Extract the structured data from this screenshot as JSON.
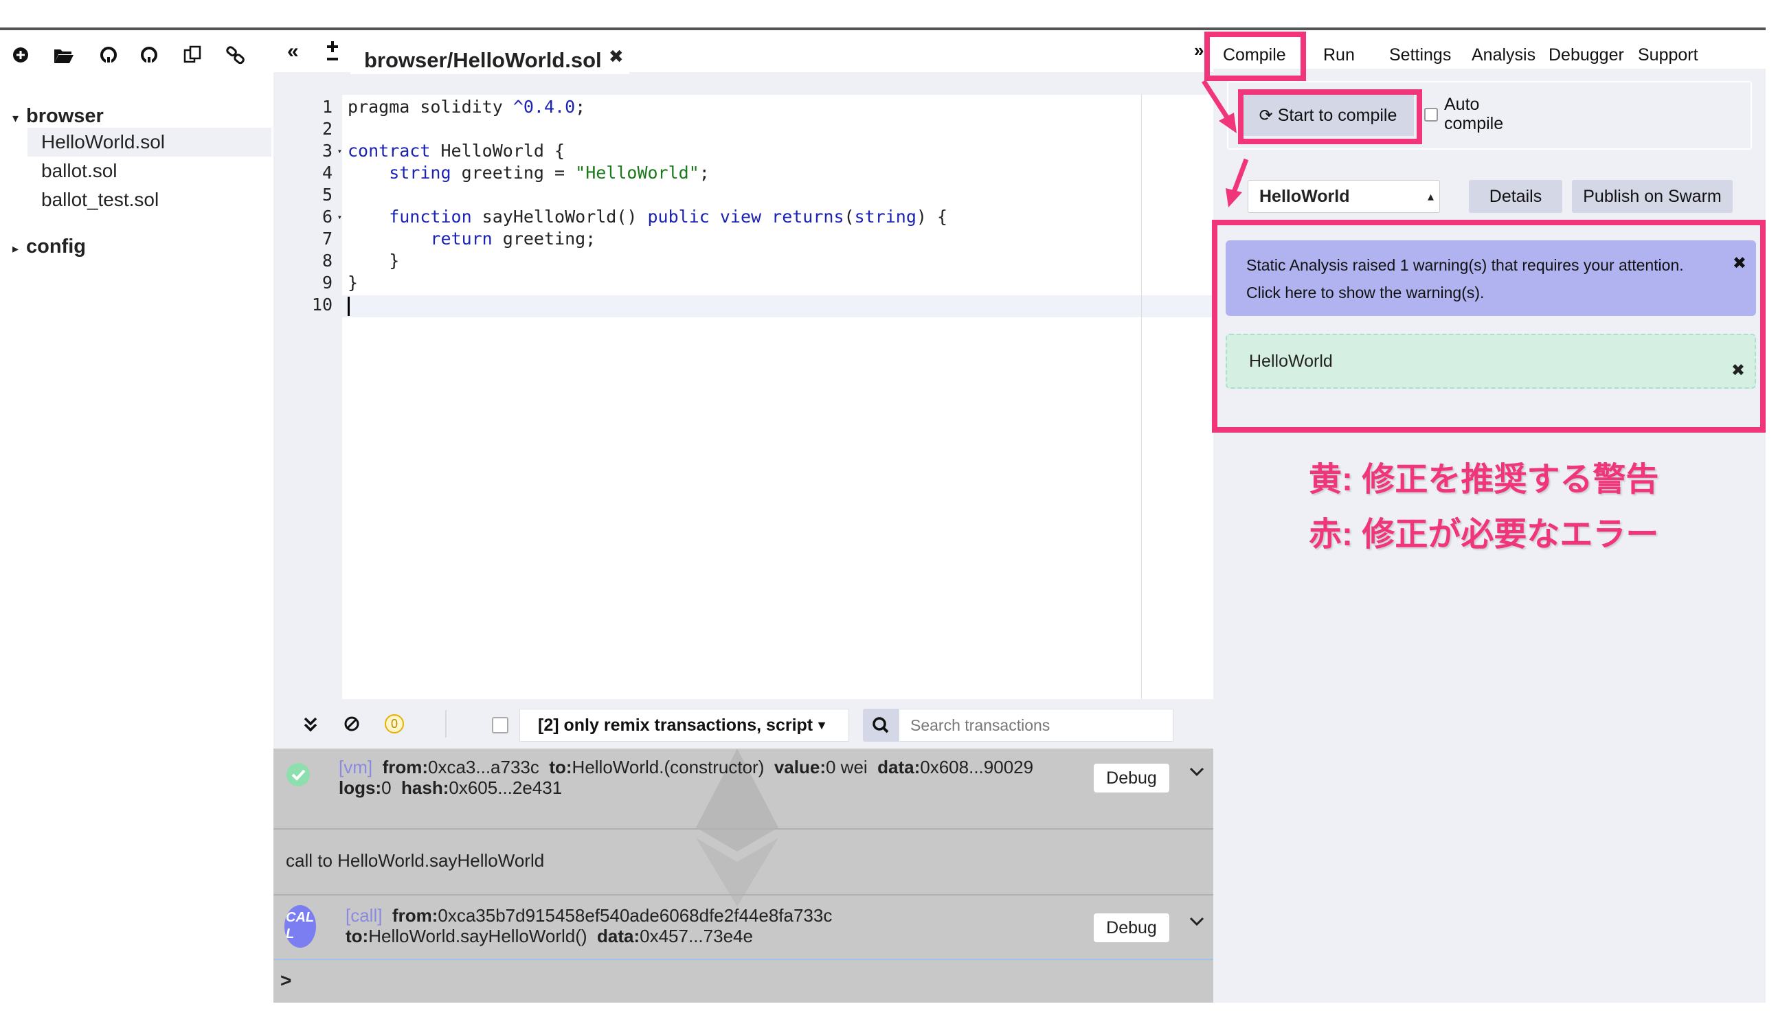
{
  "file_explorer": {
    "icons": [
      "plus-circle-icon",
      "folder-open-icon",
      "github-icon",
      "github-icon",
      "copy-icon",
      "link-icon"
    ],
    "tree": {
      "browser_folder": "browser",
      "browser_files": [
        "HelloWorld.sol",
        "ballot.sol",
        "ballot_test.sol"
      ],
      "config_folder": "config"
    }
  },
  "editor": {
    "tab_title": "browser/HelloWorld.sol",
    "line_numbers": [
      "1",
      "2",
      "3",
      "4",
      "5",
      "6",
      "7",
      "8",
      "9",
      "10"
    ],
    "code": {
      "l1a": "pragma solidity ",
      "l1b": "^0.4.0",
      "l1c": ";",
      "l3a": "contract",
      "l3b": " HelloWorld {",
      "l4a": "    string",
      "l4b": " greeting = ",
      "l4c": "\"HelloWorld\"",
      "l4d": ";",
      "l6a": "    function",
      "l6b": " sayHelloWorld() ",
      "l6c": "public",
      "l6d": " ",
      "l6e": "view",
      "l6f": " ",
      "l6g": "returns",
      "l6h": "(",
      "l6i": "string",
      "l6j": ") {",
      "l7a": "        return",
      "l7b": " greeting;",
      "l8": "    }",
      "l9": "}"
    }
  },
  "terminal": {
    "pending_count": "0",
    "filter_label": "[2] only remix transactions, script",
    "search_placeholder": "Search transactions",
    "tx1": {
      "tag": "[vm]",
      "from_label": "from:",
      "from": "0xca3...a733c",
      "to_label": "to:",
      "to": "HelloWorld.(constructor)",
      "value_label": "value:",
      "value": "0 wei",
      "data_label": "data:",
      "data": "0x608...90029",
      "logs_label": "logs:",
      "logs": "0",
      "hash_label": "hash:",
      "hash": "0x605...2e431",
      "debug": "Debug"
    },
    "call_msg": "call to HelloWorld.sayHelloWorld",
    "tx2": {
      "badge": "CAL L",
      "tag": "[call]",
      "from_label": "from:",
      "from": "0xca35b7d915458ef540ade6068dfe2f44e8fa733c",
      "to_label": "to:",
      "to": "HelloWorld.sayHelloWorld()",
      "data_label": "data:",
      "data": "0x457...73e4e",
      "debug": "Debug"
    },
    "prompt": ">"
  },
  "right_panel": {
    "tabs": [
      "Compile",
      "Run",
      "Settings",
      "Analysis",
      "Debugger",
      "Support"
    ],
    "start_compile": "Start to compile",
    "auto_compile_1": "Auto",
    "auto_compile_2": "compile",
    "contract_select": "HelloWorld",
    "details": "Details",
    "publish": "Publish on Swarm",
    "warning_1": "Static Analysis raised 1 warning(s) that requires your attention.",
    "warning_2": "Click here to show the warning(s).",
    "success_contract": "HelloWorld",
    "note_yellow": "黄: 修正を推奨する警告",
    "note_red": "赤: 修正が必要なエラー"
  },
  "colors": {
    "highlight": "#f0357a",
    "warning_bg": "#b0b3f0",
    "success_bg": "#d5f0e3",
    "keyword": "#1c23b3",
    "string": "#1a7a1a",
    "panel_bg": "#eef0f6"
  }
}
